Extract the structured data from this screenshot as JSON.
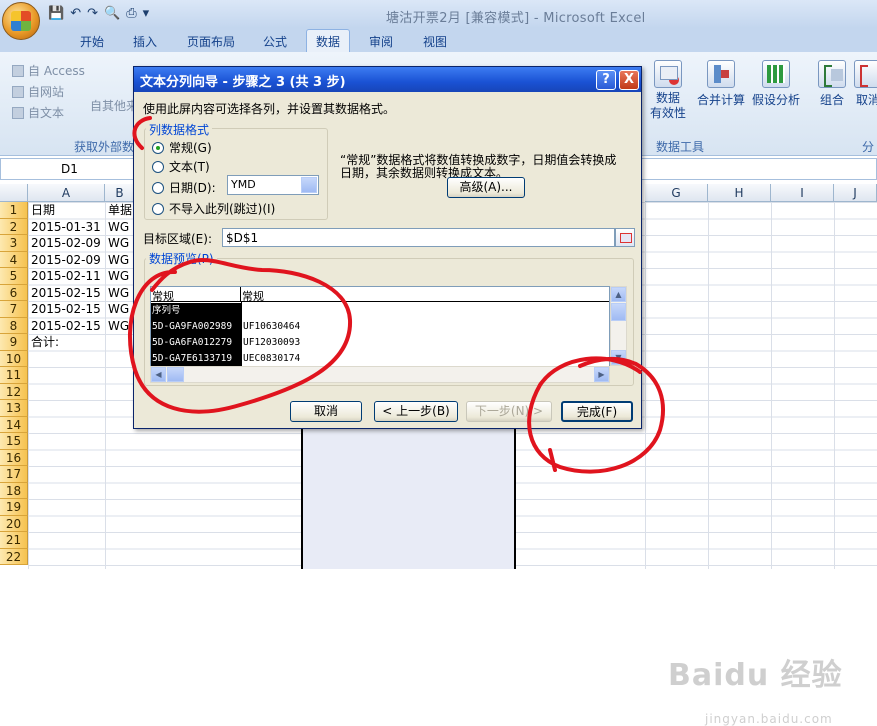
{
  "window": {
    "title": "塘沽开票2月  [兼容模式] - Microsoft Excel"
  },
  "ribbon": {
    "tabs": [
      "开始",
      "插入",
      "页面布局",
      "公式",
      "数据",
      "审阅",
      "视图"
    ],
    "active_tab": "数据",
    "external_data": {
      "items": [
        "自 Access",
        "自网站",
        "自文本"
      ],
      "other_sources": "自其他来",
      "group_label": "获取外部数"
    },
    "data_tools": {
      "buttons": [
        "数据\n有效性",
        "合并计算",
        "假设分析"
      ],
      "group_label": "数据工具"
    },
    "outline": {
      "buttons": [
        "组合",
        "取消"
      ],
      "group_label": "分"
    }
  },
  "formula_bar": {
    "name_box": "D1",
    "value": ""
  },
  "sheet": {
    "columns": [
      "A",
      "B",
      "G",
      "H",
      "I",
      "J"
    ],
    "rows": [
      "1",
      "2",
      "3",
      "4",
      "5",
      "6",
      "7",
      "8",
      "9",
      "10",
      "11",
      "12",
      "13",
      "14",
      "15",
      "16",
      "17",
      "18",
      "19",
      "20",
      "21",
      "22"
    ],
    "cells_a": [
      "日期",
      "2015-01-31",
      "2015-02-09",
      "2015-02-09",
      "2015-02-11",
      "2015-02-15",
      "2015-02-15",
      "2015-02-15",
      "合计:"
    ],
    "cells_b": [
      "单据",
      "WG",
      "WG",
      "WG",
      "WG",
      "WG",
      "WG",
      "WG"
    ]
  },
  "dialog": {
    "title": "文本分列向导 - 步骤之 3 (共 3 步)",
    "help_button": "?",
    "close_button": "X",
    "instruction": "使用此屏内容可选择各列，并设置其数据格式。",
    "format_group_label": "列数据格式",
    "options": [
      "常规(G)",
      "文本(T)",
      "日期(D):",
      "不导入此列(跳过)(I)"
    ],
    "selected_option": "常规(G)",
    "date_format": "YMD",
    "description_line1": "“常规”数据格式将数值转换成数字，日期值会转换成",
    "description_line2": "日期，其余数据则转换成文本。",
    "advanced_button": "高级(A)...",
    "destination_label": "目标区域(E):",
    "destination_value": "$D$1",
    "preview_label": "数据预览(P)",
    "preview_headers": [
      "常规",
      "常规"
    ],
    "preview_col1": [
      "序列号",
      "5D-GA9FA002989",
      "5D-GA6FA012279",
      "5D-GA7E6133719"
    ],
    "preview_col2": [
      "",
      "UF10630464",
      "UF12030093",
      "UEC0830174"
    ],
    "buttons": {
      "cancel": "取消",
      "back": "< 上一步(B)",
      "next": "下一步(N) >",
      "finish": "完成(F)"
    }
  },
  "watermark": {
    "brand": "Baidu 经验",
    "url": "jingyan.baidu.com"
  }
}
